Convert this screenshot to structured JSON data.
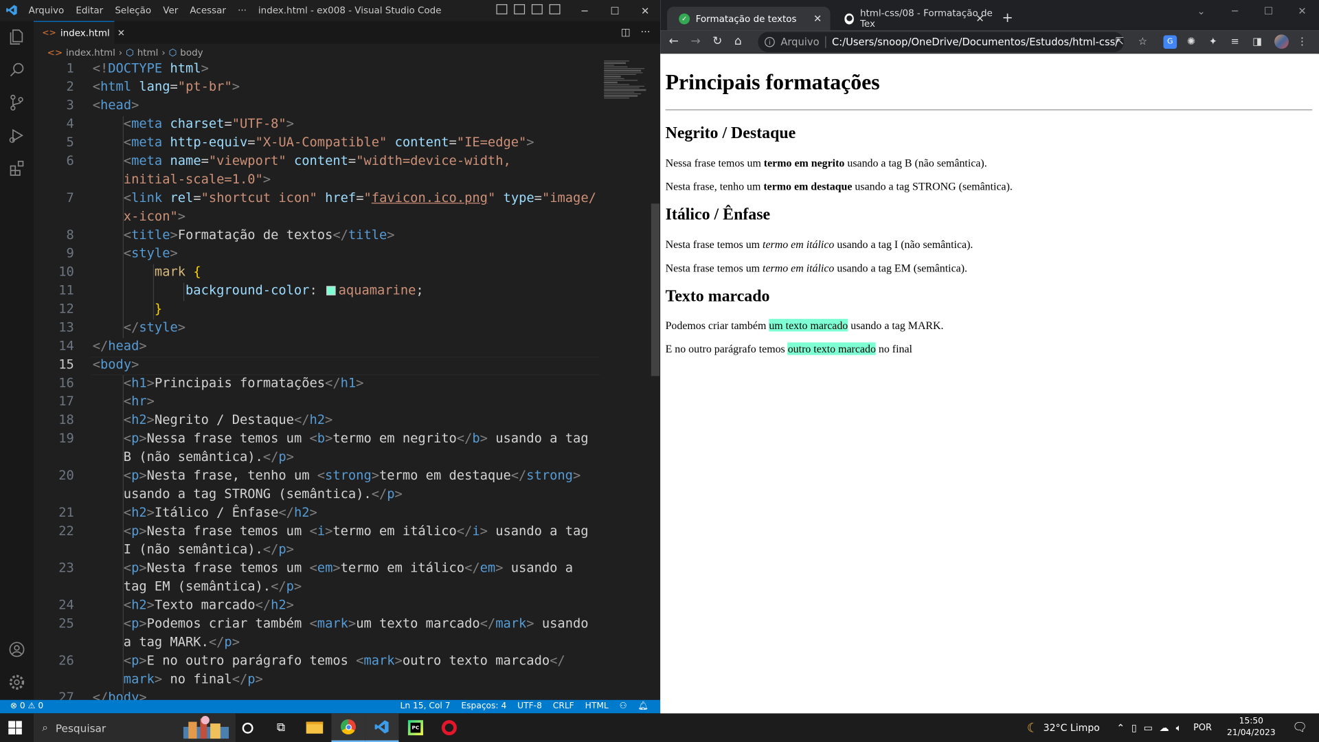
{
  "vscode": {
    "menu": [
      "Arquivo",
      "Editar",
      "Seleção",
      "Ver",
      "Acessar",
      "···"
    ],
    "window_title": "index.html - ex008 - Visual Studio Code",
    "tab_label": "index.html",
    "breadcrumb": [
      "index.html",
      "html",
      "body"
    ],
    "line_numbers": [
      "1",
      "2",
      "3",
      "4",
      "5",
      "6",
      "",
      "7",
      "",
      "8",
      "9",
      "10",
      "11",
      "12",
      "13",
      "14",
      "15",
      "16",
      "17",
      "18",
      "19",
      "",
      "20",
      "",
      "21",
      "22",
      "",
      "23",
      "",
      "24",
      "25",
      "",
      "26",
      "",
      "27"
    ],
    "status": {
      "problems": "⊗ 0 ⚠ 0",
      "position": "Ln 15, Col 7",
      "spaces": "Espaços: 4",
      "encoding": "UTF-8",
      "eol": "CRLF",
      "language": "HTML"
    }
  },
  "browser": {
    "tabs": [
      {
        "title": "Formatação de textos",
        "active": true
      },
      {
        "title": "html-css/08 - Formatação de Tex",
        "active": false
      }
    ],
    "address": {
      "scheme": "Arquivo",
      "url": "C:/Users/snoop/OneDrive/Documentos/Estudos/html-css/exercic..."
    },
    "page": {
      "h1": "Principais formatações",
      "sections": [
        {
          "h2": "Negrito / Destaque"
        },
        {
          "h2": "Itálico / Ênfase"
        },
        {
          "h2": "Texto marcado"
        }
      ],
      "p1_before": "Nessa frase temos um ",
      "p1_em": "termo em negrito",
      "p1_after": " usando a tag B (não semântica).",
      "p2_before": "Nesta frase, tenho um ",
      "p2_em": "termo em destaque",
      "p2_after": " usando a tag STRONG (semântica).",
      "p3_before": "Nesta frase temos um ",
      "p3_em": "termo em itálico",
      "p3_after": " usando a tag I (não semântica).",
      "p4_before": "Nesta frase temos um ",
      "p4_em": "termo em itálico",
      "p4_after": " usando a tag EM (semântica).",
      "p5_before": "Podemos criar também ",
      "p5_mark": "um texto marcado",
      "p5_after": " usando a tag MARK.",
      "p6_before": "E no outro parágrafo temos ",
      "p6_mark": "outro texto marcado",
      "p6_after": " no final"
    }
  },
  "taskbar": {
    "search_placeholder": "Pesquisar",
    "weather": "32°C  Limpo",
    "lang": "POR",
    "time": "15:50",
    "date": "21/04/2023"
  },
  "colors": {
    "vscode_accent": "#007acc",
    "mark_highlight": "#7fffd4"
  }
}
